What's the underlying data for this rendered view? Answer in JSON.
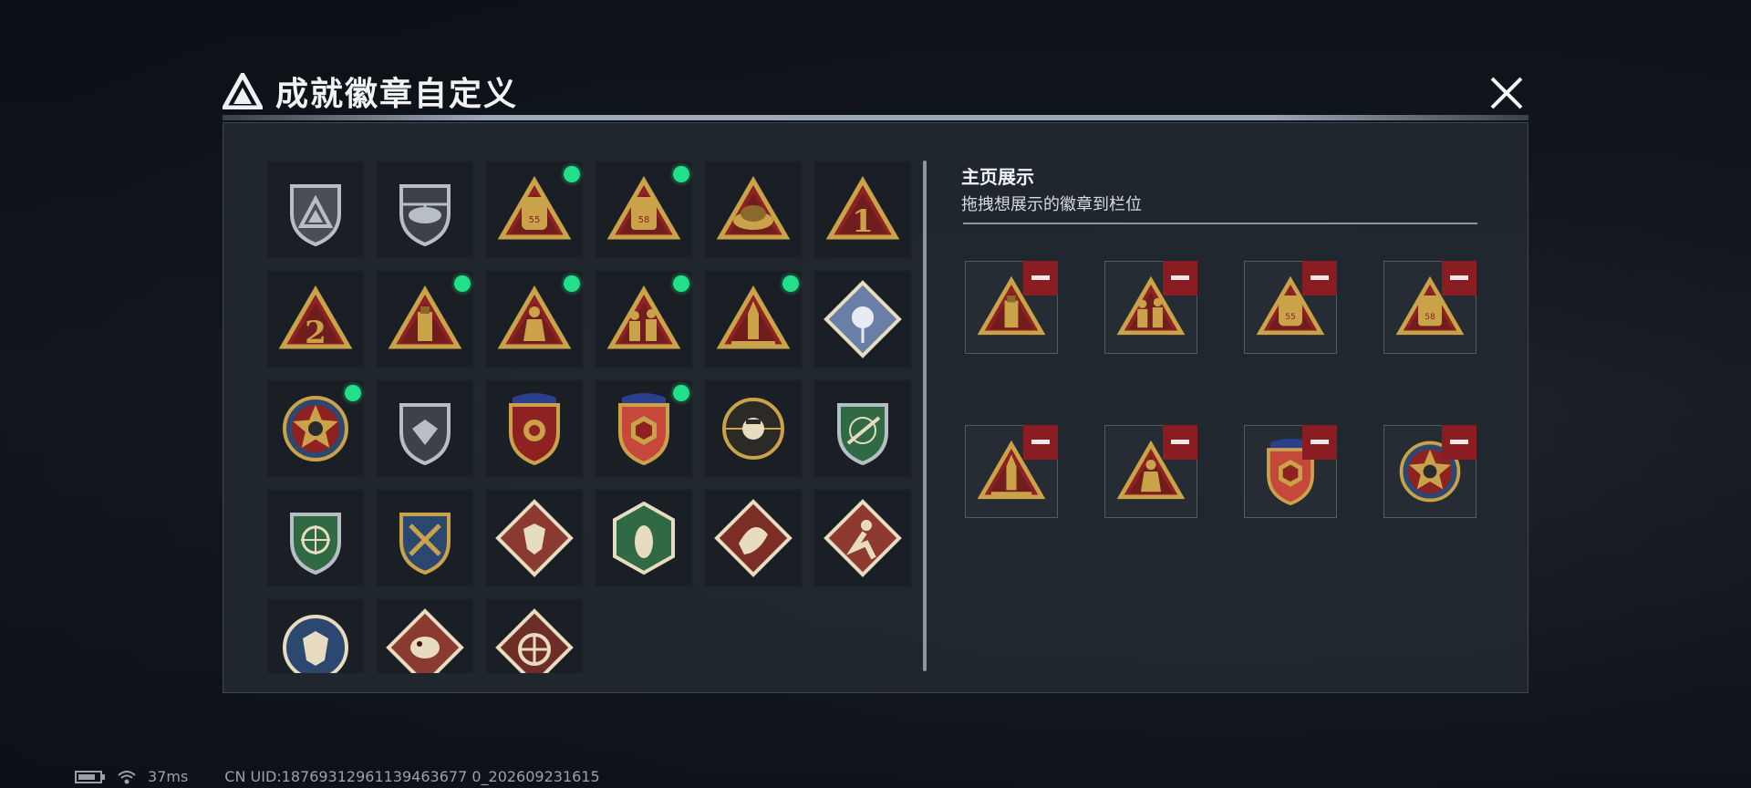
{
  "dialog": {
    "title": "成就徽章自定义",
    "logo_icon": "triangle-logo-icon",
    "close_icon": "close-icon"
  },
  "badges": [
    {
      "icon": "shield-logo-badge",
      "new": false
    },
    {
      "icon": "helicopter-badge",
      "new": false
    },
    {
      "icon": "backpack-55-badge",
      "new": true
    },
    {
      "icon": "backpack-58-badge",
      "new": true
    },
    {
      "icon": "bread-badge",
      "new": false
    },
    {
      "icon": "number-1-badge",
      "new": false
    },
    {
      "icon": "number-2-badge",
      "new": false
    },
    {
      "icon": "usb-badge",
      "new": true
    },
    {
      "icon": "crouching-figure-badge",
      "new": true
    },
    {
      "icon": "soldiers-badge",
      "new": true
    },
    {
      "icon": "rocket-badge",
      "new": true
    },
    {
      "icon": "rose-badge",
      "new": false
    },
    {
      "icon": "star-emblem-badge",
      "new": true
    },
    {
      "icon": "silver-shield-badge",
      "new": false
    },
    {
      "icon": "gold-wing-shield-badge",
      "new": false
    },
    {
      "icon": "red-hexagon-shield-badge",
      "new": true
    },
    {
      "icon": "skull-crosshair-badge",
      "new": false
    },
    {
      "icon": "green-rifle-shield-badge",
      "new": false
    },
    {
      "icon": "green-crosshair-shield-badge",
      "new": false
    },
    {
      "icon": "crossed-swords-gold-badge",
      "new": false
    },
    {
      "icon": "wolf-badge",
      "new": false
    },
    {
      "icon": "wasp-badge",
      "new": false
    },
    {
      "icon": "dragon-badge",
      "new": false
    },
    {
      "icon": "runner-badge",
      "new": false
    },
    {
      "icon": "blue-wolf-badge",
      "new": false
    },
    {
      "icon": "lizard-badge",
      "new": false
    },
    {
      "icon": "wheel-badge",
      "new": false
    }
  ],
  "showcase": {
    "title": "主页展示",
    "subtitle": "拖拽想展示的徽章到栏位",
    "remove_icon": "minus-icon",
    "slots": [
      {
        "icon": "usb-badge"
      },
      {
        "icon": "soldiers-badge"
      },
      {
        "icon": "backpack-55-badge"
      },
      {
        "icon": "backpack-58-badge"
      },
      {
        "icon": "rocket-badge"
      },
      {
        "icon": "crouching-figure-badge"
      },
      {
        "icon": "red-hexagon-shield-badge"
      },
      {
        "icon": "star-emblem-badge"
      }
    ]
  },
  "status": {
    "battery_icon": "battery-icon",
    "wifi_icon": "wifi-icon",
    "ping": "37ms",
    "uid": "CN UID:18769312961139463677 0_202609231615"
  },
  "colors": {
    "gold": "#c9a24a",
    "red": "#8e2222",
    "new_dot": "#22e08a",
    "remove_red": "#8a1d22"
  }
}
